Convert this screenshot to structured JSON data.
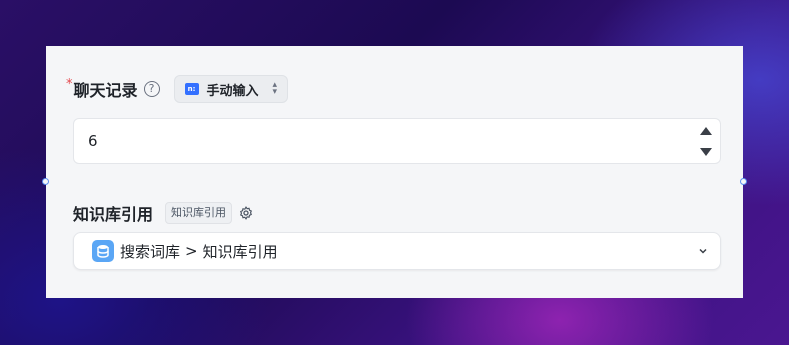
{
  "history": {
    "required_mark": "*",
    "label": "聊天记录",
    "help_icon": "question-circle-icon",
    "source_select": {
      "icon": "input-box-icon",
      "icon_text": "n:",
      "value": "手动输入",
      "arrows": "updown-icon"
    },
    "count_value": "6"
  },
  "knowledge": {
    "label": "知识库引用",
    "tag": "知识库引用",
    "settings_icon": "gear-icon",
    "select": {
      "icon": "database-icon",
      "part1": "搜索词库",
      "separator": ">",
      "part2": "知识库引用",
      "dropdown_icon": "chevron-down-icon"
    }
  },
  "colors": {
    "accent": "#3370ff",
    "required": "#e5484d",
    "db_icon": "#5aa6f5"
  }
}
